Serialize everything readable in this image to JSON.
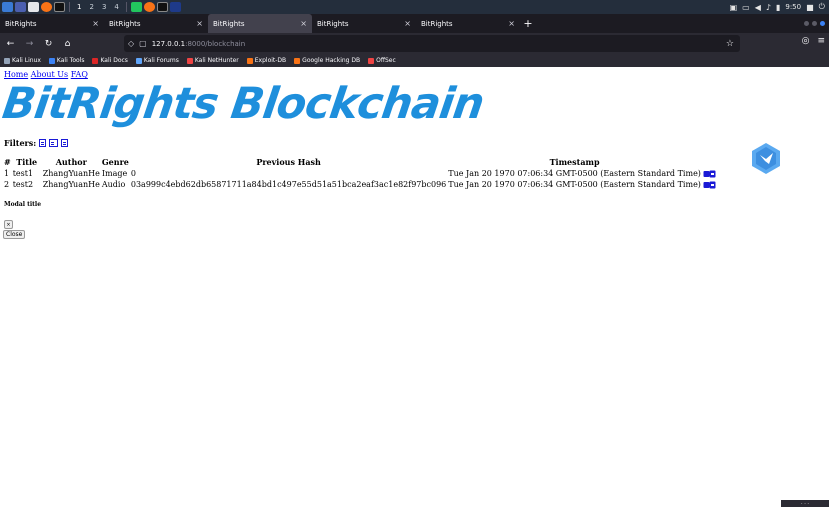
{
  "taskbar": {
    "workspaces": [
      "1",
      "2",
      "3",
      "4"
    ],
    "clock": "9:50"
  },
  "browser": {
    "tabs": [
      {
        "label": "BitRights",
        "active": false
      },
      {
        "label": "BitRights",
        "active": false
      },
      {
        "label": "BitRights",
        "active": true
      },
      {
        "label": "BitRights",
        "active": false
      },
      {
        "label": "BitRights",
        "active": false
      }
    ],
    "url_host": "127.0.0.1",
    "url_path": ":8000/blockchain",
    "bookmarks": [
      {
        "label": "Kali Linux",
        "color": "#94a3b8"
      },
      {
        "label": "Kali Tools",
        "color": "#3b82f6"
      },
      {
        "label": "Kali Docs",
        "color": "#dc2626"
      },
      {
        "label": "Kali Forums",
        "color": "#60a5fa"
      },
      {
        "label": "Kali NetHunter",
        "color": "#ef4444"
      },
      {
        "label": "Exploit-DB",
        "color": "#f97316"
      },
      {
        "label": "Google Hacking DB",
        "color": "#f97316"
      },
      {
        "label": "OffSec",
        "color": "#ef4444"
      }
    ]
  },
  "page": {
    "nav": {
      "home": "Home",
      "about": "About Us",
      "faq": "FAQ"
    },
    "logo_text": "BitRights Blockchain",
    "filters_label": "Filters:",
    "table": {
      "headers": [
        "#",
        "Title",
        "Author",
        "Genre",
        "Previous Hash",
        "Timestamp"
      ],
      "rows": [
        {
          "num": "1",
          "title": "test1",
          "author": "ZhangYuanHe",
          "genre": "Image",
          "hash": "0",
          "timestamp": "Tue Jan 20 1970 07:06:34 GMT-0500 (Eastern Standard Time)"
        },
        {
          "num": "2",
          "title": "test2",
          "author": "ZhangYuanHe",
          "genre": "Audio",
          "hash": "03a999c4ebd62db65871711a84bd1c497e55d51a51bca2eaf3ac1e82f97bc096",
          "timestamp": "Tue Jan 20 1970 07:06:34 GMT-0500 (Eastern Standard Time)"
        }
      ]
    },
    "modal": {
      "title": "Modal title",
      "x_label": "×",
      "close_label": "Close"
    }
  },
  "colors": {
    "logo": "#1e8fdc",
    "link": "#0000ee",
    "icon_blue": "#1a1ad6"
  }
}
